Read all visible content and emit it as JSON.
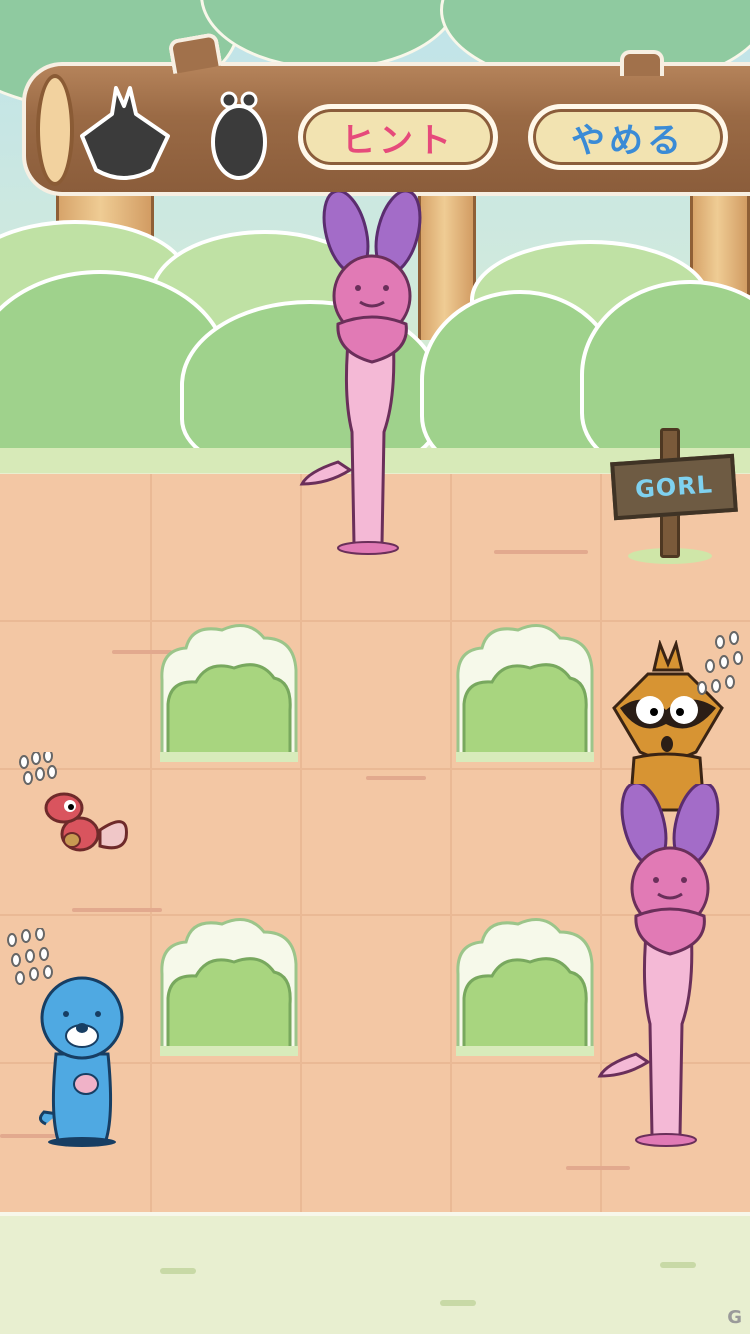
{
  "header": {
    "hint_button": "ヒント",
    "quit_button": "やめる",
    "silhouettes": [
      "raccoon-silhouette-icon",
      "chipmunk-silhouette-icon"
    ]
  },
  "board": {
    "goal_sign": "GORL",
    "rows": 5,
    "cols": 5,
    "bushes": [
      "r2c2",
      "r2c4",
      "r4c2",
      "r4c4"
    ],
    "characters": [
      {
        "name": "pink-rabbit",
        "cell": "r1c3"
      },
      {
        "name": "raccoon",
        "cell": "r2c5"
      },
      {
        "name": "chipmunk",
        "cell": "r3c1"
      },
      {
        "name": "blue-seal",
        "cell": "r4c1"
      },
      {
        "name": "pink-rabbit",
        "cell": "r4c5"
      }
    ]
  },
  "colors": {
    "hint_text": "#e64a7b",
    "quit_text": "#3a8bd6",
    "ground": "#f3c7a4",
    "sign_text": "#7fd1ef"
  },
  "watermark": "G"
}
